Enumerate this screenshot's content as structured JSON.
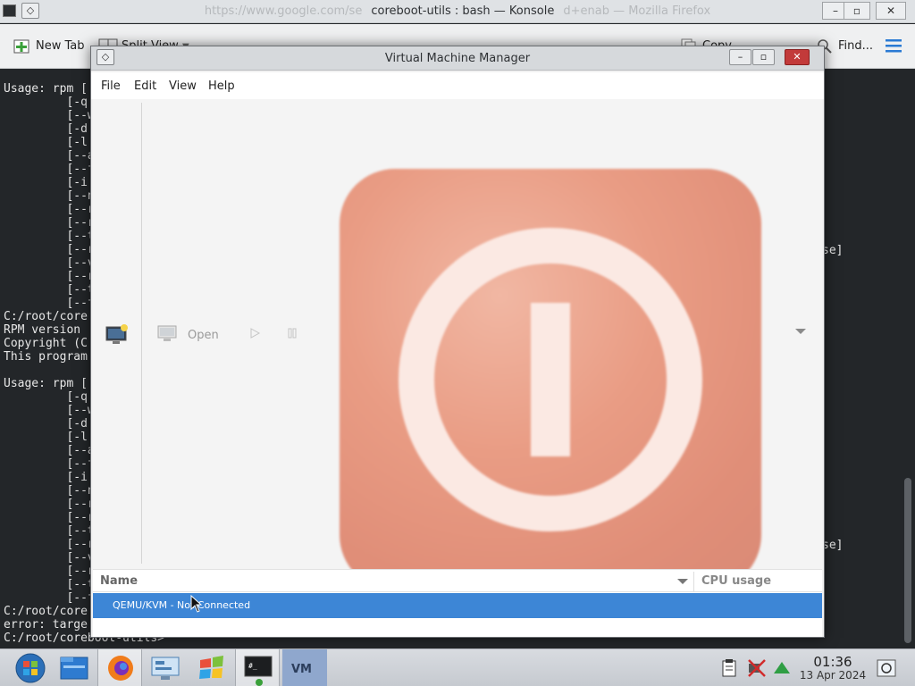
{
  "konsole": {
    "title": "coreboot-utils : bash — Konsole",
    "ghost_title_left": "https://www.google.com/se",
    "ghost_title_right": "d+enab — Mozilla Firefox",
    "toolbar": {
      "new_tab": "New Tab",
      "split_view": "Split View",
      "copy": "Copy",
      "find": "Find..."
    },
    "output_lines": [
      "Usage: rpm [",
      "         [-q|",
      "         [--w",
      "         [-d|",
      "         [-l|",
      "         [--a",
      "         [--f",
      "         [-i|",
      "         [--n",
      "         [--r",
      "         [--r",
      "         [--t",
      "         [--r",
      "         [--v",
      "         [--r",
      "         [--t",
      "         [--f",
      "C:/root/core",
      "RPM version",
      "Copyright (C",
      "This program",
      "",
      "Usage: rpm [",
      "         [-q|",
      "         [--w",
      "         [-d|",
      "         [-l|",
      "         [--a",
      "         [--f",
      "         [-i|",
      "         [--n",
      "         [--r",
      "         [--r",
      "         [--t",
      "         [--r",
      "         [--v",
      "         [--r",
      "         [--t",
      "         [--f",
      "C:/root/core",
      "error: targe",
      "C:/root/coreboot-utils>"
    ],
    "right_fragment_1": "se]",
    "right_fragment_2": "se]"
  },
  "vmm": {
    "title": "Virtual Machine Manager",
    "menu": [
      "File",
      "Edit",
      "View",
      "Help"
    ],
    "toolbar": {
      "open_label": "Open"
    },
    "list": {
      "col_name": "Name",
      "col_cpu": "CPU usage",
      "rows": [
        {
          "name": "QEMU/KVM - Not Connected"
        }
      ]
    }
  },
  "taskbar": {
    "clock_time": "01:36",
    "clock_date": "13 Apr 2024"
  },
  "colors": {
    "selection": "#3d86d6",
    "logo": "#e08e78",
    "close": "#c23a3a"
  }
}
